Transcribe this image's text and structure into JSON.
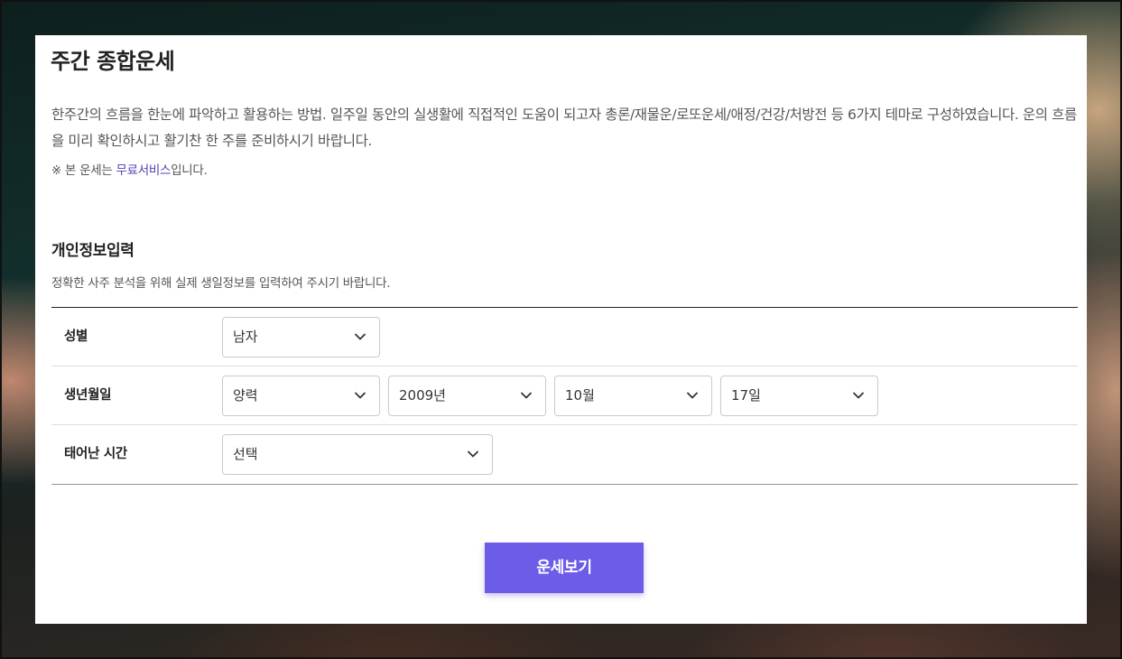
{
  "page": {
    "title": "주간 종합운세",
    "intro": "한주간의 흐름을 한눈에 파악하고 활용하는 방법. 일주일 동안의 실생활에 직접적인 도움이 되고자 총론/재물운/로또운세/애정/건강/처방전 등 6가지 테마로 구성하였습니다. 운의 흐름을 미리 확인하시고 활기찬 한 주를 준비하시기 바랍니다.",
    "notice_prefix": "※ 본 운세는 ",
    "notice_highlight": "무료서비스",
    "notice_suffix": "입니다."
  },
  "form": {
    "title": "개인정보입력",
    "description": "정확한 사주 분석을 위해 실제 생일정보를 입력하여 주시기 바랍니다.",
    "gender": {
      "label": "성별",
      "value": "남자"
    },
    "birth": {
      "label": "생년월일",
      "calendar": "양력",
      "year": "2009년",
      "month": "10월",
      "day": "17일"
    },
    "time": {
      "label": "태어난 시간",
      "value": "선택"
    },
    "submit_label": "운세보기"
  },
  "colors": {
    "accent": "#6c5ce7",
    "highlight_text": "#4e3fb0"
  },
  "icons": {
    "dropdown": "chevron-down-icon"
  }
}
